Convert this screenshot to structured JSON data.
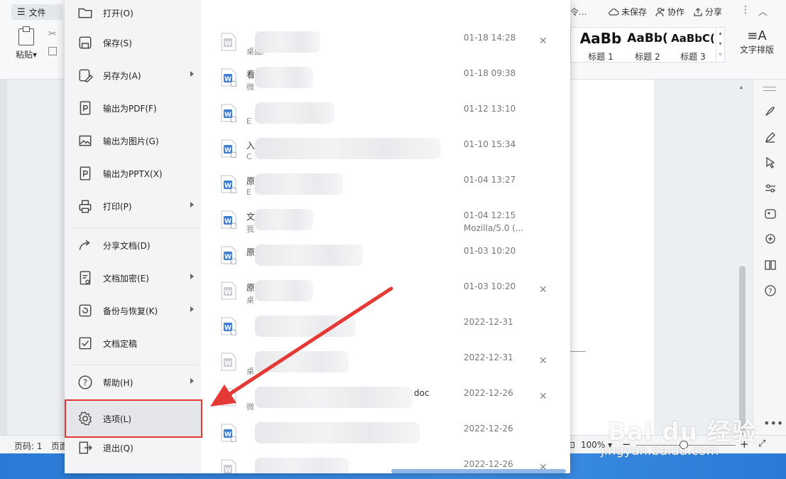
{
  "ribbon": {
    "file_button": "文件",
    "paste_label": "粘贴",
    "cut_text": "剪",
    "topbar_cut": "令...",
    "unsaved": "未保存",
    "collaborate": "协作",
    "share": "分享",
    "styles": [
      {
        "sample": "AaBb",
        "label": "标题 1"
      },
      {
        "sample": "AaBb(",
        "label": "标题 2"
      },
      {
        "sample": "AaBbC(",
        "label": "标题 3"
      }
    ],
    "text_layout": "文字排版"
  },
  "file_menu": {
    "items": [
      {
        "label": "打开(O)",
        "icon": "folder-open-icon",
        "submenu": false
      },
      {
        "label": "保存(S)",
        "icon": "save-icon",
        "submenu": false
      },
      {
        "label": "另存为(A)",
        "icon": "save-as-icon",
        "submenu": true
      },
      {
        "label": "输出为PDF(F)",
        "icon": "export-pdf-icon",
        "submenu": false
      },
      {
        "label": "输出为图片(G)",
        "icon": "export-image-icon",
        "submenu": false
      },
      {
        "label": "输出为PPTX(X)",
        "icon": "export-pptx-icon",
        "submenu": false
      },
      {
        "label": "打印(P)",
        "icon": "printer-icon",
        "submenu": true
      },
      {
        "label": "分享文档(D)",
        "icon": "share-doc-icon",
        "submenu": false
      },
      {
        "label": "文档加密(E)",
        "icon": "encrypt-doc-icon",
        "submenu": true
      },
      {
        "label": "备份与恢复(K)",
        "icon": "backup-restore-icon",
        "submenu": true
      },
      {
        "label": "文档定稿",
        "icon": "finalize-doc-icon",
        "submenu": false
      },
      {
        "label": "帮助(H)",
        "icon": "help-icon",
        "submenu": true
      },
      {
        "label": "选项(L)",
        "icon": "gear-icon",
        "submenu": false
      },
      {
        "label": "退出(Q)",
        "icon": "exit-icon",
        "submenu": false
      }
    ]
  },
  "recent_files": [
    {
      "name": "",
      "path": "桌面/",
      "date": "01-18 14:28",
      "sub": "",
      "closable": true,
      "grey": true
    },
    {
      "name": "看",
      "path": "微",
      "date": "01-18 09:38",
      "sub": "",
      "closable": false,
      "grey": false
    },
    {
      "name": "",
      "path": "E",
      "date": "01-12 13:10",
      "sub": "",
      "closable": false,
      "grey": false
    },
    {
      "name": "入",
      "path": "C",
      "date": "01-10 15:34",
      "sub": "",
      "closable": false,
      "grey": false
    },
    {
      "name": "原",
      "path": "E",
      "date": "01-04 13:27",
      "sub": "",
      "closable": false,
      "grey": false
    },
    {
      "name": "文",
      "path": "我",
      "date": "01-04 12:15",
      "sub": "Mozilla/5.0 (...",
      "closable": false,
      "grey": false
    },
    {
      "name": "原",
      "path": "",
      "date": "01-03 10:20",
      "sub": "",
      "closable": false,
      "grey": false
    },
    {
      "name": "原",
      "path": "桌",
      "date": "01-03 10:20",
      "sub": "",
      "closable": true,
      "grey": true
    },
    {
      "name": "",
      "path": "",
      "date": "2022-12-31",
      "sub": "",
      "closable": false,
      "grey": false
    },
    {
      "name": "",
      "path": "桌",
      "date": "2022-12-31",
      "sub": "",
      "closable": true,
      "grey": true
    },
    {
      "name": "doc",
      "path": "微",
      "date": "2022-12-26",
      "sub": "",
      "closable": true,
      "grey": true
    },
    {
      "name": "",
      "path": "",
      "date": "2022-12-26",
      "sub": "",
      "closable": false,
      "grey": false
    },
    {
      "name": "",
      "path": "",
      "date": "2022-12-26",
      "sub": "",
      "closable": true,
      "grey": true
    }
  ],
  "statusbar": {
    "page": "页码: 1",
    "page2": "页面",
    "zoom": "100%"
  },
  "watermark": {
    "brand": "Bai du 经验",
    "url": "jingyan.baidu.com"
  },
  "colors": {
    "accent_blue": "#3e7fd6",
    "highlight_red": "#e53935"
  }
}
